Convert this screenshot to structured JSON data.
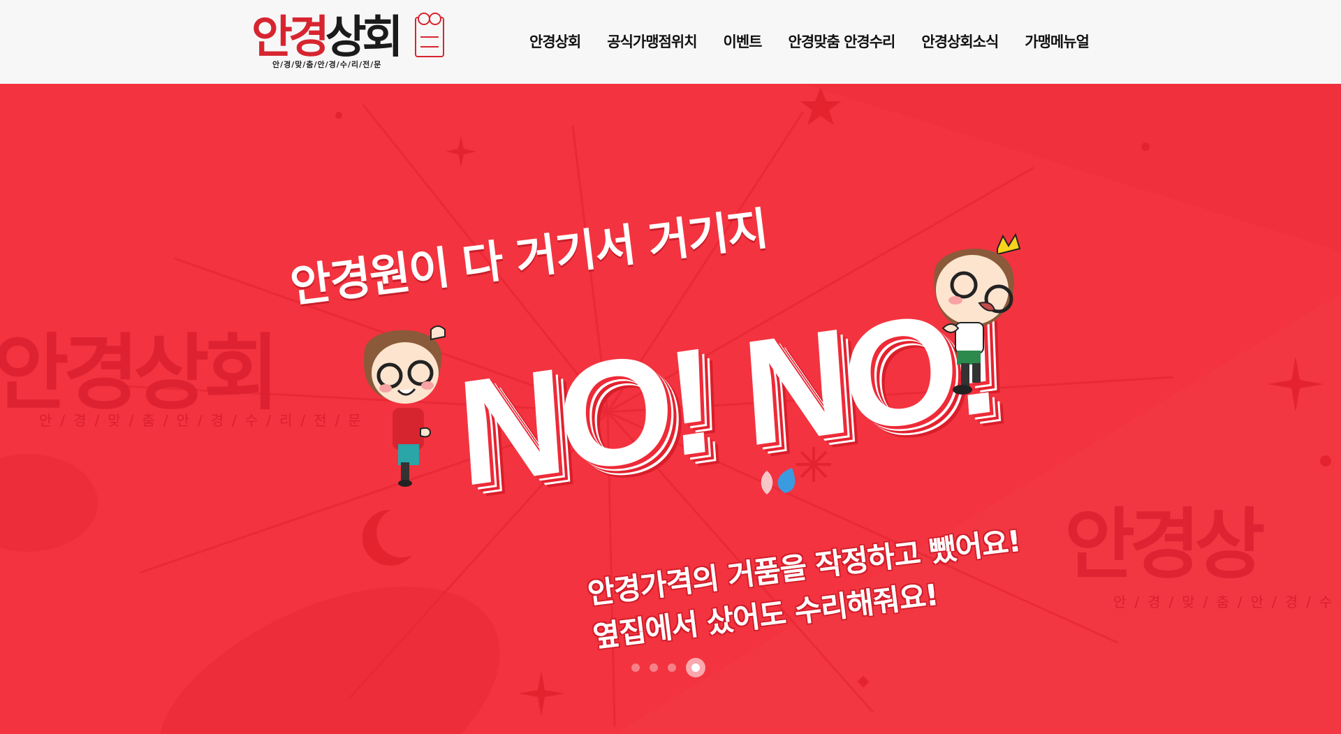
{
  "logo": {
    "part1": "안경",
    "part2": "상회",
    "subtitle": "안/경/맞/춤/안/경/수/리/전/문",
    "seal_icon": "seal-stamp-icon"
  },
  "nav": {
    "items": [
      {
        "label": "안경상회"
      },
      {
        "label": "공식가맹점위치"
      },
      {
        "label": "이벤트"
      },
      {
        "label": "안경맞춤 안경수리"
      },
      {
        "label": "안경상회소식"
      },
      {
        "label": "가맹메뉴얼"
      }
    ]
  },
  "hero": {
    "headline": "안경원이 다 거기서 거기지",
    "big_text": "NO! NO!",
    "tagline_line1": "안경가격의 거품을 작정하고 뺐어요!",
    "tagline_line2": "옆집에서 샀어도 수리해줘요!",
    "ghost_brand": "안경상회",
    "ghost_subtitle": "안/경/맞/춤/안/경/수/리/전/문",
    "ghost_brand_right": "안경상",
    "ghost_subtitle_right": "안/경/맞/춤/안/경/수/리/전",
    "background_color": "#f3333f"
  },
  "slider": {
    "total": 4,
    "active_index": 3
  },
  "colors": {
    "brand_red": "#d7252f",
    "header_bg": "#f7f7f7"
  }
}
